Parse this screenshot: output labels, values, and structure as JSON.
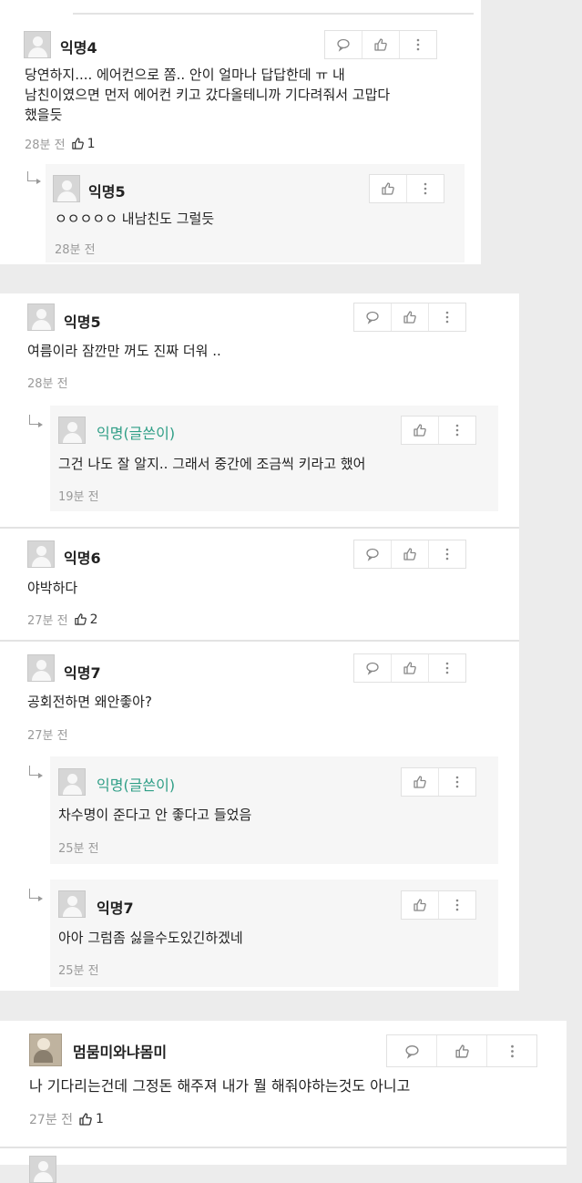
{
  "icons": {
    "reply": "speech-bubble-icon",
    "like": "thumbs-up-icon",
    "more": "vertical-dots-icon"
  },
  "colors": {
    "author_name": "#2e9e86",
    "meta": "#9a9a9a",
    "background": "#ececec"
  },
  "comments": {
    "c1": {
      "name": "익명4",
      "lines": [
        "당연하지.... 에어컨으로 쫌.. 안이 얼마나 답답한데 ㅠ 내",
        "남친이였으면 먼저 에어컨 키고 갔다올테니까 기다려줘서 고맙다",
        "했을듯"
      ],
      "time": "28분 전",
      "likes": "1"
    },
    "r1": {
      "name": "익명5",
      "text": "ㅇㅇㅇㅇㅇ 내남친도 그럴듯",
      "time": "28분 전"
    },
    "c2": {
      "name": "익명5",
      "text": "여름이라 잠깐만 꺼도 진짜 더워 ..",
      "time": "28분 전"
    },
    "r2": {
      "name": "익명(글쓴이)",
      "text": "그건 나도 잘 알지.. 그래서 중간에 조금씩 키라고 했어",
      "time": "19분 전"
    },
    "c3": {
      "name": "익명6",
      "text": "야박하다",
      "time": "27분 전",
      "likes": "2"
    },
    "c4": {
      "name": "익명7",
      "text": "공회전하면 왜안좋아?",
      "time": "27분 전"
    },
    "r3": {
      "name": "익명(글쓴이)",
      "text": "차수명이 준다고 안 좋다고 들었음",
      "time": "25분 전"
    },
    "r4": {
      "name": "익명7",
      "text": "아아 그럼좀 싫을수도있긴하겠네",
      "time": "25분 전"
    },
    "c5": {
      "name": "멈뭄미와냐몸미",
      "text": "나 기다리는건데 그정돈 해주져 내가 뭘 해줘야하는것도 아니고",
      "time": "27분 전",
      "likes": "1"
    }
  }
}
